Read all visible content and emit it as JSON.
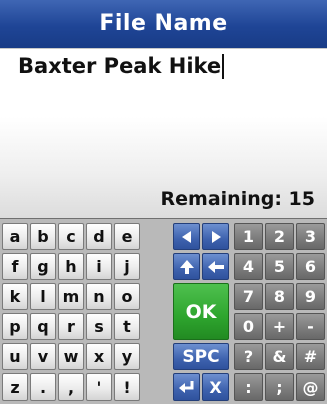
{
  "title_bar": {
    "title": "File Name"
  },
  "input": {
    "value": "Baxter Peak Hike"
  },
  "status": {
    "remaining_label": "Remaining: 15"
  },
  "keyboard": {
    "ok_label": "OK",
    "space_label": "SPC",
    "rows": [
      [
        "a",
        "b",
        "c",
        "d",
        "e",
        "left-arrow-icon",
        "right-arrow-icon",
        "1",
        "2",
        "3"
      ],
      [
        "f",
        "g",
        "h",
        "i",
        "j",
        "shift-up-icon",
        "backspace-icon",
        "4",
        "5",
        "6"
      ],
      [
        "k",
        "l",
        "m",
        "n",
        "o",
        "OK",
        "OK",
        "7",
        "8",
        "9"
      ],
      [
        "p",
        "q",
        "r",
        "s",
        "t",
        "OK",
        "OK",
        "0",
        "+",
        "-"
      ],
      [
        "u",
        "v",
        "w",
        "x",
        "y",
        "SPC",
        "SPC",
        "?",
        "&",
        "#"
      ],
      [
        "z",
        ".",
        ",",
        "'",
        "!",
        "enter-icon",
        "X",
        ":",
        ";",
        "@"
      ]
    ],
    "colors": {
      "letter": "#e6e6e6",
      "nav": "#3e62ae",
      "digit": "#7b7b7b",
      "ok": "#2ea52e"
    }
  }
}
